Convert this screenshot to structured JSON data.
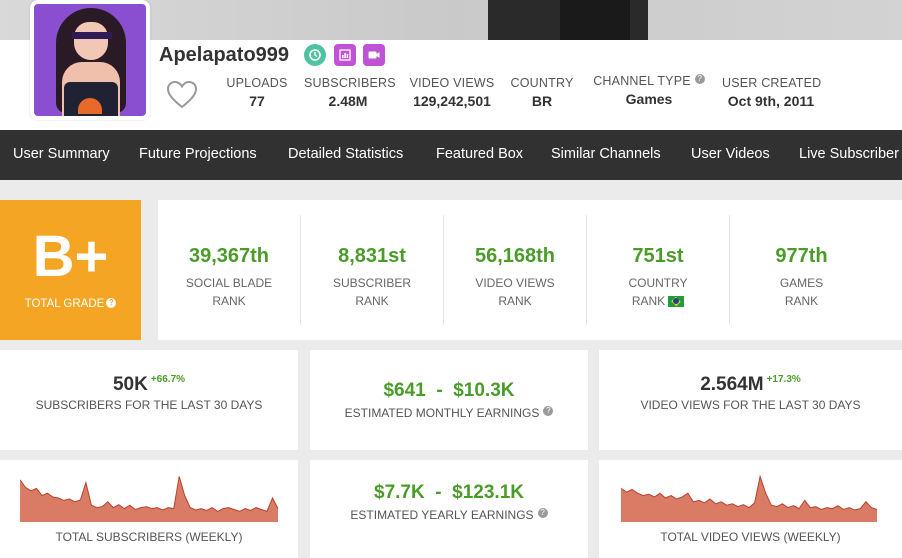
{
  "channel": {
    "name": "Apelapato999",
    "badges": [
      "partner-icon",
      "stats-icon",
      "video-icon"
    ]
  },
  "header_stats": [
    {
      "label": "UPLOADS",
      "value": "77"
    },
    {
      "label": "SUBSCRIBERS",
      "value": "2.48M"
    },
    {
      "label": "VIDEO VIEWS",
      "value": "129,242,501"
    },
    {
      "label": "COUNTRY",
      "value": "BR"
    },
    {
      "label": "CHANNEL TYPE",
      "value": "Games"
    },
    {
      "label": "USER CREATED",
      "value": "Oct 9th, 2011"
    }
  ],
  "nav": [
    "User Summary",
    "Future Projections",
    "Detailed Statistics",
    "Featured Box",
    "Similar Channels",
    "User Videos",
    "Live Subscriber"
  ],
  "grade": {
    "letter": "B+",
    "label": "TOTAL GRADE",
    "color": "#f5a524"
  },
  "ranks": [
    {
      "value": "39,367th",
      "line1": "SOCIAL BLADE",
      "line2": "RANK"
    },
    {
      "value": "8,831st",
      "line1": "SUBSCRIBER",
      "line2": "RANK"
    },
    {
      "value": "56,168th",
      "line1": "VIDEO VIEWS",
      "line2": "RANK"
    },
    {
      "value": "751st",
      "line1": "COUNTRY",
      "line2": "RANK"
    },
    {
      "value": "977th",
      "line1": "GAMES",
      "line2": "RANK"
    }
  ],
  "cards": {
    "subs30": {
      "value": "50K",
      "delta": "+66.7%",
      "label": "SUBSCRIBERS FOR THE LAST 30 DAYS"
    },
    "monthly": {
      "low": "$641",
      "sep": "-",
      "high": "$10.3K",
      "label": "ESTIMATED MONTHLY EARNINGS"
    },
    "views30": {
      "value": "2.564M",
      "delta": "+17.3%",
      "label": "VIDEO VIEWS FOR THE LAST 30 DAYS"
    },
    "subs_weekly": {
      "label": "TOTAL SUBSCRIBERS (WEEKLY)"
    },
    "yearly": {
      "low": "$7.7K",
      "sep": "-",
      "high": "$123.1K",
      "label": "ESTIMATED YEARLY EARNINGS"
    },
    "views_weekly": {
      "label": "TOTAL VIDEO VIEWS (WEEKLY)"
    }
  },
  "colors": {
    "green": "#4a9c28",
    "nav_bg": "#313131",
    "spark": "#d4644b"
  },
  "sparklines": {
    "subs": [
      0.88,
      0.72,
      0.65,
      0.7,
      0.55,
      0.6,
      0.52,
      0.5,
      0.45,
      0.48,
      0.42,
      0.46,
      0.82,
      0.35,
      0.3,
      0.32,
      0.42,
      0.3,
      0.36,
      0.28,
      0.35,
      0.26,
      0.3,
      0.32,
      0.28,
      0.3,
      0.25,
      0.3,
      0.28,
      0.95,
      0.55,
      0.3,
      0.25,
      0.28,
      0.24,
      0.3,
      0.22,
      0.28,
      0.3,
      0.26,
      0.22,
      0.28,
      0.24,
      0.3,
      0.26,
      0.22,
      0.5,
      0.28
    ],
    "views": [
      0.7,
      0.62,
      0.68,
      0.6,
      0.55,
      0.58,
      0.52,
      0.6,
      0.5,
      0.55,
      0.48,
      0.52,
      0.6,
      0.42,
      0.45,
      0.4,
      0.48,
      0.38,
      0.42,
      0.35,
      0.38,
      0.32,
      0.36,
      0.3,
      0.4,
      0.95,
      0.6,
      0.35,
      0.32,
      0.38,
      0.3,
      0.34,
      0.28,
      0.45,
      0.3,
      0.32,
      0.26,
      0.3,
      0.28,
      0.34,
      0.26,
      0.3,
      0.25,
      0.28,
      0.42,
      0.3,
      0.26
    ]
  }
}
